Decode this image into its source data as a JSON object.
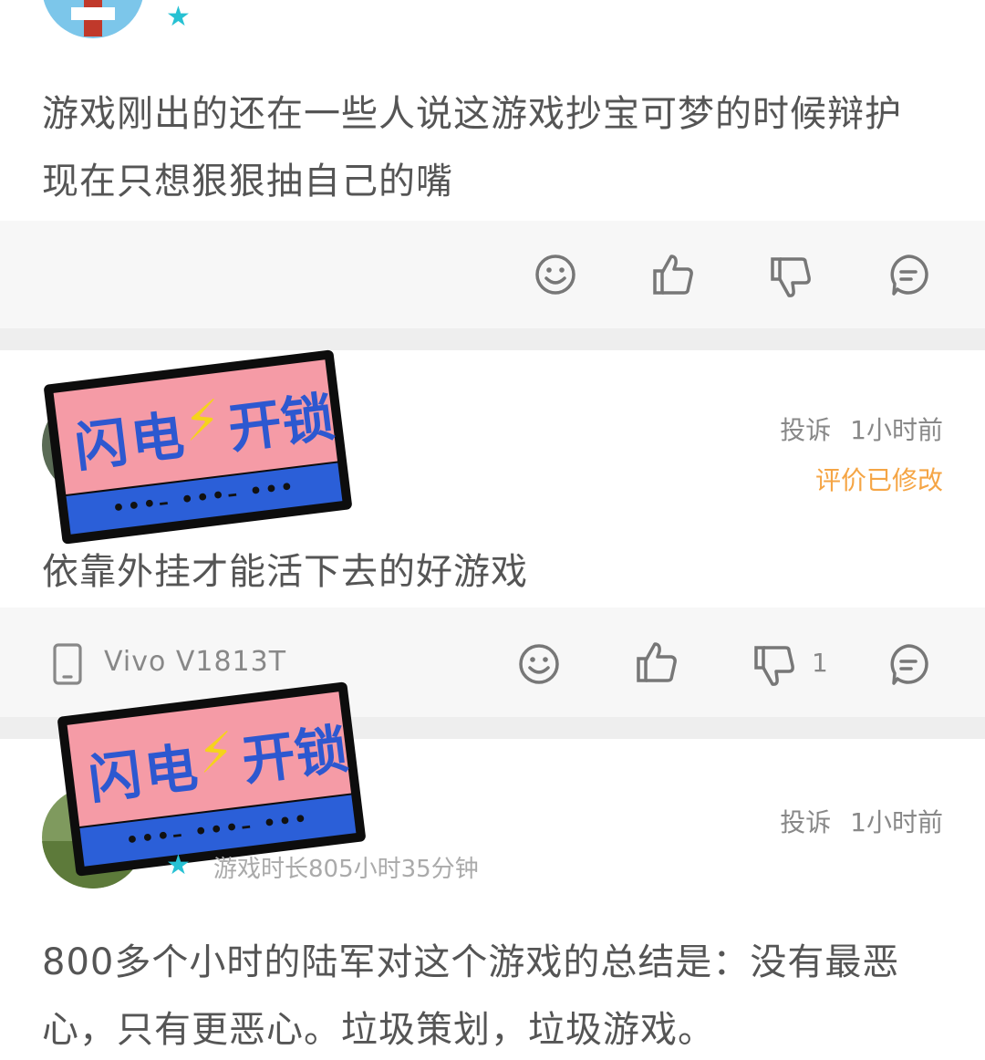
{
  "comment1": {
    "text_line1": "游戏刚出的还在一些人说这游戏抄宝可梦的时候辩护",
    "text_line2": "现在只想狠狠抽自己的嘴"
  },
  "comment2": {
    "report_label": "投诉",
    "time": "1小时前",
    "edited_label": "评价已修改",
    "text": "依靠外挂才能活下去的好游戏",
    "device": "Vivo V1813T",
    "dislike_count": "1"
  },
  "comment3": {
    "report_label": "投诉",
    "time": "1小时前",
    "playtime": "游戏时长805小时35分钟",
    "text_line1": "800多个小时的陆军对这个游戏的总结是：没有最恶",
    "text_line2": "心，只有更恶心。垃圾策划，垃圾游戏。"
  },
  "watermark": {
    "char1": "闪",
    "char2": "电",
    "char3": "开",
    "char4": "锁",
    "bolt": "⚡"
  },
  "colors": {
    "star": "#27c1d3",
    "edited": "#f5a545",
    "action_bg": "#f7f7f7",
    "icon": "#777777"
  },
  "icons": [
    "emoji-icon",
    "thumbs-up-icon",
    "thumbs-down-icon",
    "reply-icon",
    "phone-icon",
    "star-icon"
  ]
}
